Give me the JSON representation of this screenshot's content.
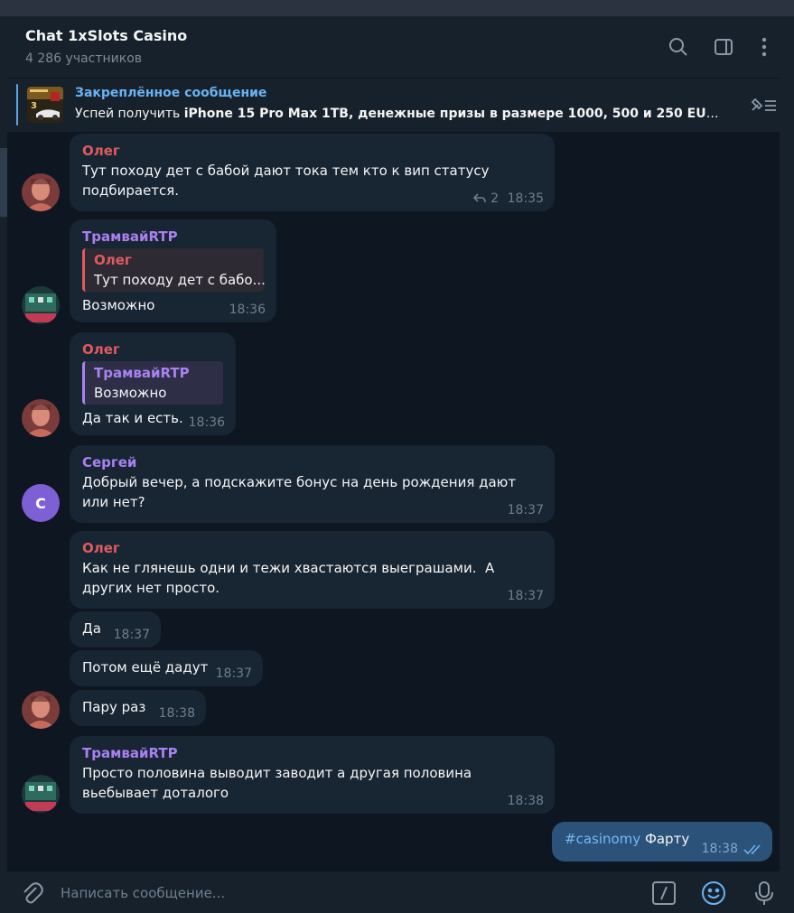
{
  "header": {
    "title": "Chat 1xSlots Casino",
    "subtitle": "4 286 участников",
    "icons": [
      "search-icon",
      "sidebar-toggle-icon",
      "more-vertical-icon"
    ]
  },
  "pinned": {
    "label": "Закреплённое сообщение",
    "text_prefix": "Успей получить ",
    "text_bold": "iPhone 15 Pro Max 1TB, денежные призы в размере 1000, 500 и 250 EUR ...",
    "icon": "unpin-list-icon"
  },
  "messages": [
    {
      "sender": "Олег",
      "text": "Тут походу дет с бабой дают тока тем кто к вип статусу подбирается.",
      "replies": "2",
      "time": "18:35"
    },
    {
      "sender": "ТрамвайRTP",
      "quote_sender": "Олег",
      "quote_text": "Тут походу дет с бабо...",
      "text": "Возможно",
      "time": "18:36"
    },
    {
      "sender": "Олег",
      "quote_sender": "ТрамвайRTP",
      "quote_text": "Возможно",
      "text": "Да так и есть.",
      "time": "18:36"
    },
    {
      "sender": "Сергей",
      "avatar_letter": "С",
      "text": "Добрый вечер, а подскажите бонус на день рождения дают или нет?",
      "time": "18:37"
    },
    {
      "sender": "Олег",
      "text": "Как не глянешь одни и тежи хвастаются выеграшами.  А других нет просто.",
      "time": "18:37"
    },
    {
      "text": "Да",
      "time": "18:37"
    },
    {
      "text": "Потом ещё дадут",
      "time": "18:37"
    },
    {
      "text": "Пару раз",
      "time": "18:38"
    },
    {
      "sender": "ТрамвайRTP",
      "text": "Просто половина выводит заводит а другая половина вьебывает доталого",
      "time": "18:38"
    }
  ],
  "outgoing": {
    "hashtag": "#casinomy",
    "text": "Фарту",
    "time": "18:38",
    "status": "read"
  },
  "composer": {
    "placeholder": "Написать сообщение...",
    "icons": [
      "attach-icon",
      "commands-icon",
      "emoji-icon",
      "microphone-icon"
    ]
  },
  "colors": {
    "background": "#0e1621",
    "bubble_in": "#182533",
    "bubble_out": "#2b5278",
    "accent": "#6ab3f3",
    "oleg": "#e05a5f",
    "purple": "#a981f0"
  }
}
